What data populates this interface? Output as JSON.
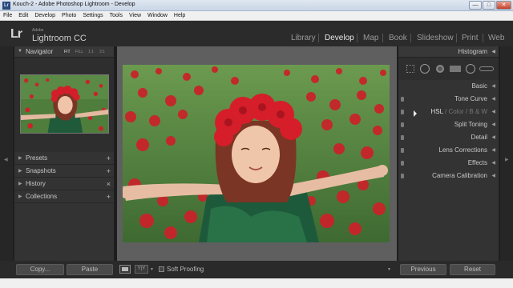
{
  "window": {
    "title": "Kouch-2 - Adobe Photoshop Lightroom - Develop",
    "min_label": "—",
    "max_label": "□",
    "close_label": "✕"
  },
  "menu": [
    "File",
    "Edit",
    "Develop",
    "Photo",
    "Settings",
    "Tools",
    "View",
    "Window",
    "Help"
  ],
  "identity": {
    "logo": "Lr",
    "adobe": "Adobe",
    "product": "Lightroom CC"
  },
  "modules": [
    "Library",
    "Develop",
    "Map",
    "Book",
    "Slideshow",
    "Print",
    "Web"
  ],
  "active_module": "Develop",
  "navigator": {
    "title": "Navigator",
    "zoom": [
      "FIT",
      "FILL",
      "1:1",
      "3:1"
    ]
  },
  "left_sections": [
    {
      "label": "Presets",
      "action": "+"
    },
    {
      "label": "Snapshots",
      "action": "+"
    },
    {
      "label": "History",
      "action": "×"
    },
    {
      "label": "Collections",
      "action": "+"
    }
  ],
  "right": {
    "histogram": "Histogram",
    "sections": [
      "Basic",
      "Tone Curve",
      "HSL / Color / B & W",
      "Split Toning",
      "Detail",
      "Lens Corrections",
      "Effects",
      "Camera Calibration"
    ]
  },
  "hsl": {
    "hsl": "HSL",
    "color": "Color",
    "bw": "B & W",
    "sep": "/"
  },
  "bottom": {
    "copy": "Copy...",
    "paste": "Paste",
    "soft_proofing": "Soft Proofing",
    "previous": "Previous",
    "reset": "Reset"
  },
  "colors": {
    "panel": "#333333",
    "background": "#1e1e1e",
    "canvas": "#5f5f5f"
  }
}
